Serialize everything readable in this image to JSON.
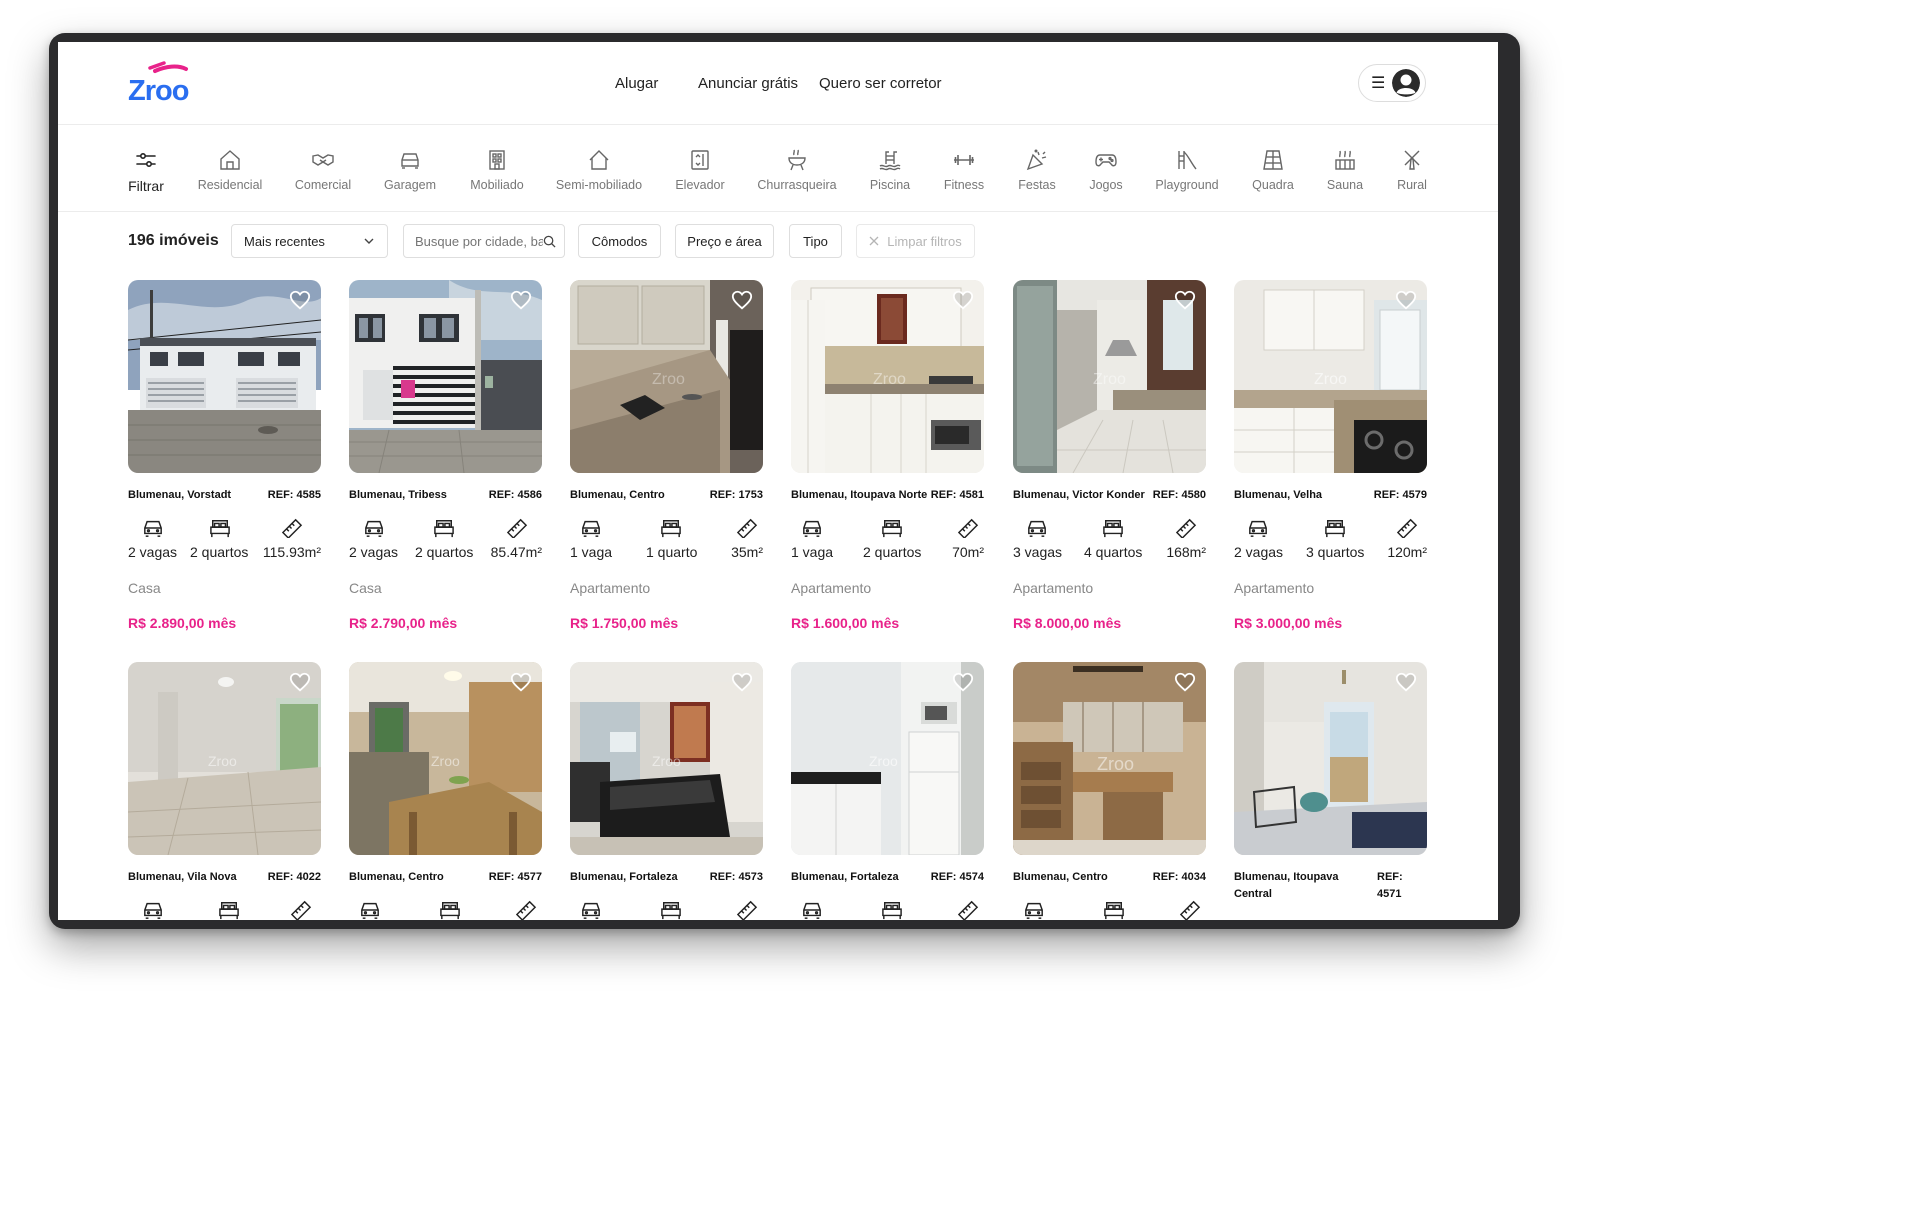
{
  "brand": {
    "name": "Zroo",
    "accent": "#e8228a",
    "blue": "#2a6ef0"
  },
  "nav": {
    "rent": "Alugar",
    "advertise": "Anunciar grátis",
    "broker": "Quero ser corretor"
  },
  "user_menu": {
    "menu_icon": "hamburger-icon",
    "avatar_icon": "user-icon"
  },
  "categories": [
    {
      "label": "Filtrar",
      "icon": "sliders-icon"
    },
    {
      "label": "Residencial",
      "icon": "house-icon"
    },
    {
      "label": "Comercial",
      "icon": "handshake-icon"
    },
    {
      "label": "Garagem",
      "icon": "car-icon"
    },
    {
      "label": "Mobiliado",
      "icon": "building-icon"
    },
    {
      "label": "Semi-mobiliado",
      "icon": "home-outline-icon"
    },
    {
      "label": "Elevador",
      "icon": "elevator-icon"
    },
    {
      "label": "Churrasqueira",
      "icon": "grill-icon"
    },
    {
      "label": "Piscina",
      "icon": "pool-icon"
    },
    {
      "label": "Fitness",
      "icon": "dumbbell-icon"
    },
    {
      "label": "Festas",
      "icon": "party-icon"
    },
    {
      "label": "Jogos",
      "icon": "gamepad-icon"
    },
    {
      "label": "Playground",
      "icon": "slide-icon"
    },
    {
      "label": "Quadra",
      "icon": "court-icon"
    },
    {
      "label": "Sauna",
      "icon": "sauna-icon"
    },
    {
      "label": "Rural",
      "icon": "windmill-icon"
    }
  ],
  "filters": {
    "count": "196 imóveis",
    "sort": "Mais recentes",
    "search_placeholder": "Busque por cidade, bairro",
    "rooms": "Cômodos",
    "price_area": "Preço e área",
    "type": "Tipo",
    "clear": "Limpar filtros"
  },
  "listings": [
    {
      "loc": "Blumenau, Vorstadt",
      "ref": "REF: 4585",
      "spots": "2 vagas",
      "rooms": "2 quartos",
      "area": "115.93m²",
      "type": "Casa",
      "price": "R$ 2.890,00 mês",
      "photo": "townhouse"
    },
    {
      "loc": "Blumenau, Tribess",
      "ref": "REF: 4586",
      "spots": "2 vagas",
      "rooms": "2 quartos",
      "area": "85.47m²",
      "type": "Casa",
      "price": "R$ 2.790,00 mês",
      "photo": "gatehouse"
    },
    {
      "loc": "Blumenau, Centro",
      "ref": "REF: 1753",
      "spots": "1 vaga",
      "rooms": "1 quarto",
      "area": "35m²",
      "type": "Apartamento",
      "price": "R$ 1.750,00 mês",
      "photo": "kitchen-beige"
    },
    {
      "loc": "Blumenau, Itoupava Norte",
      "ref": "REF: 4581",
      "spots": "1 vaga",
      "rooms": "2 quartos",
      "area": "70m²",
      "type": "Apartamento",
      "price": "R$ 1.600,00 mês",
      "photo": "kitchen-white"
    },
    {
      "loc": "Blumenau, Victor Konder",
      "ref": "REF: 4580",
      "spots": "3 vagas",
      "rooms": "4 quartos",
      "area": "168m²",
      "type": "Apartamento",
      "price": "R$ 8.000,00 mês",
      "photo": "kitchen-dark"
    },
    {
      "loc": "Blumenau, Velha",
      "ref": "REF: 4579",
      "spots": "2 vagas",
      "rooms": "3 quartos",
      "area": "120m²",
      "type": "Apartamento",
      "price": "R$ 3.000,00 mês",
      "photo": "kitchen-granite"
    },
    {
      "loc": "Blumenau, Vila Nova",
      "ref": "REF: 4022",
      "photo": "room-empty"
    },
    {
      "loc": "Blumenau, Centro",
      "ref": "REF: 4577",
      "photo": "living-wood"
    },
    {
      "loc": "Blumenau, Fortaleza",
      "ref": "REF: 4573",
      "photo": "sofa-black"
    },
    {
      "loc": "Blumenau, Fortaleza",
      "ref": "REF: 4574",
      "photo": "fridge"
    },
    {
      "loc": "Blumenau, Centro",
      "ref": "REF: 4034",
      "photo": "office-wood"
    },
    {
      "loc": "Blumenau, Itoupava Central",
      "ref": "REF: 4571",
      "photo": "room-balcony"
    }
  ],
  "card_icons": {
    "spots": "car-icon",
    "rooms": "bed-icon",
    "area": "ruler-icon",
    "favorite": "heart-icon"
  }
}
